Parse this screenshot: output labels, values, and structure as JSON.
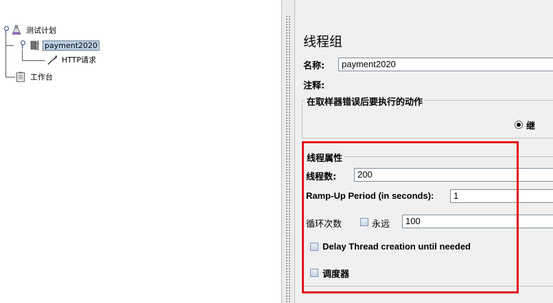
{
  "tree": {
    "items": [
      {
        "label": "测试计划"
      },
      {
        "label": "payment2020"
      },
      {
        "label": "HTTP请求"
      },
      {
        "label": "工作台"
      }
    ]
  },
  "panel": {
    "title": "线程组",
    "name_label": "名称:",
    "name_value": "payment2020",
    "comment_label": "注释:",
    "error_group_title": "在取样器错误后要执行的动作",
    "error_option_label": "继",
    "thread_props": {
      "title": "线程属性",
      "threads_label": "线程数:",
      "threads_value": "200",
      "rampup_label": "Ramp-Up Period (in seconds):",
      "rampup_value": "1",
      "loop_label": "循环次数",
      "forever_label": "永远",
      "forever_checked": false,
      "loop_value": "100",
      "delay_label": "Delay Thread creation until needed",
      "delay_checked": false,
      "scheduler_label": "调度器",
      "scheduler_checked": false
    }
  },
  "colors": {
    "highlight": "#e2121b",
    "selection": "#b8cfe5",
    "panel_bg": "#f0f0f0"
  },
  "icons": [
    "test-plan-flask-icon",
    "thread-group-icon",
    "http-sampler-pipette-icon",
    "workbench-clipboard-icon"
  ]
}
